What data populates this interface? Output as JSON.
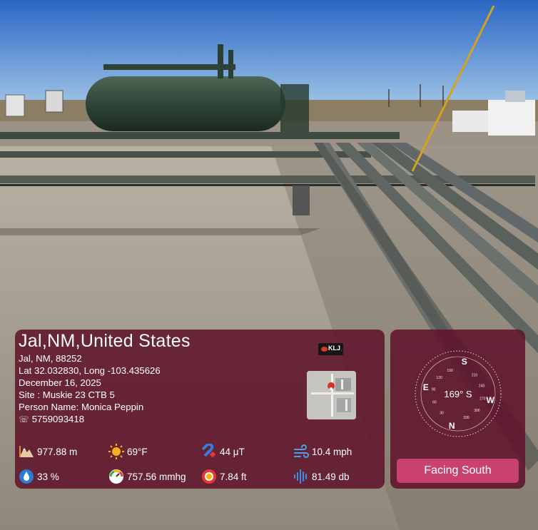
{
  "location": {
    "title": "Jal,NM,United States",
    "lines": [
      "Jal, NM, 88252",
      "Lat 32.032830, Long -103.435626",
      "December 16, 2025",
      "Site : Muskie 23 CTB 5",
      "Person Name: Monica Peppin"
    ],
    "phone": "5759093418",
    "logo_text": "KLJ"
  },
  "stats": {
    "altitude": "977.88 m",
    "temperature": "69°F",
    "magnetic": "44 μT",
    "wind": "10.4 mph",
    "humidity": "33 %",
    "pressure": "757.56 mmhg",
    "accuracy": "7.84 ft",
    "sound": "81.49 db"
  },
  "compass": {
    "heading": "169° S",
    "button_label": "Facing South",
    "cardinals": [
      "S",
      "W",
      "N",
      "E"
    ],
    "degree_ticks": [
      "150",
      "120",
      "90",
      "60",
      "30",
      "330",
      "300",
      "270",
      "240",
      "210"
    ]
  },
  "colors": {
    "panel": "#60122a",
    "button": "#c8416f"
  },
  "icons": [
    "mountain-icon",
    "sun-icon",
    "magnet-icon",
    "wind-icon",
    "humidity-icon",
    "pressure-gauge-icon",
    "location-accuracy-icon",
    "sound-wave-icon",
    "phone-icon"
  ]
}
